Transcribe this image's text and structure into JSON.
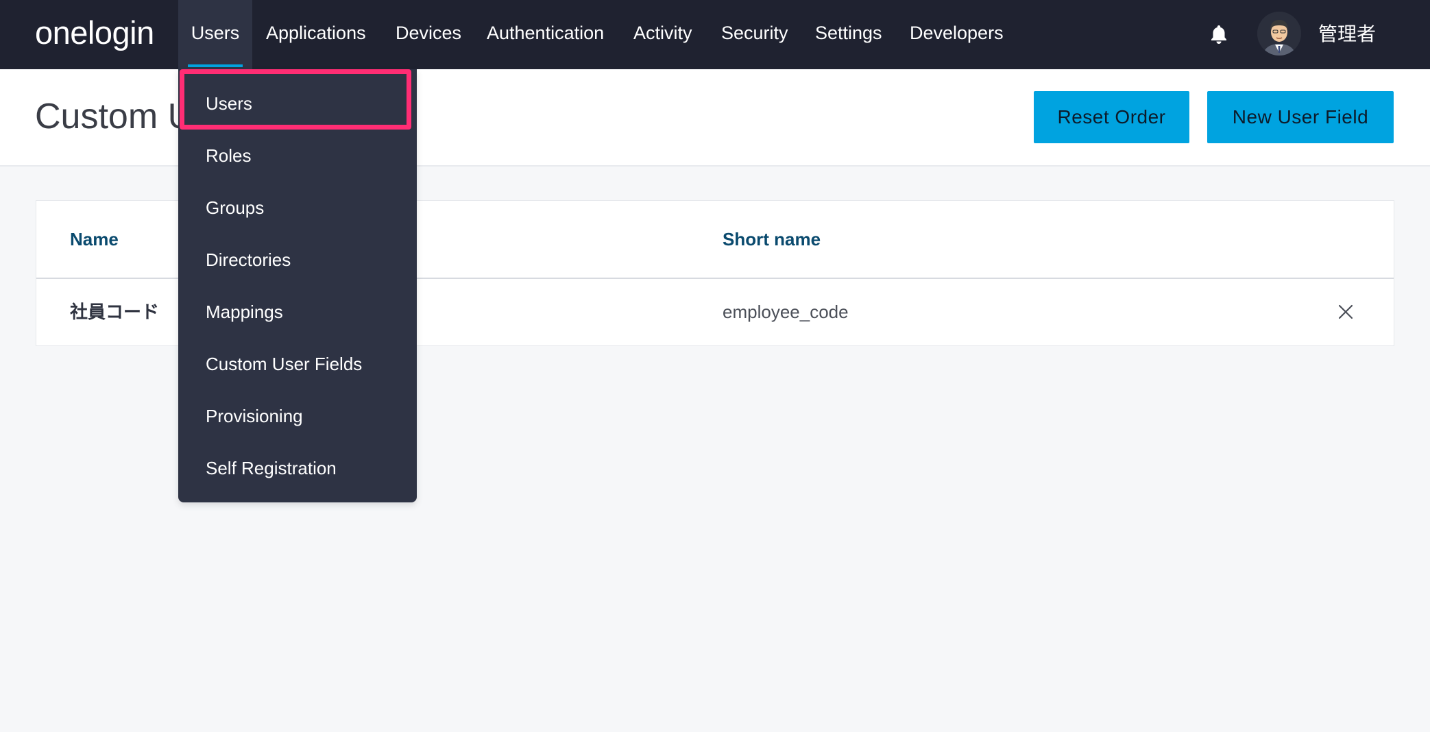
{
  "brand": {
    "logo_text": "onelogin"
  },
  "nav": {
    "items": [
      {
        "label": "Users",
        "active": true
      },
      {
        "label": "Applications"
      },
      {
        "label": "Devices"
      },
      {
        "label": "Authentication"
      },
      {
        "label": "Activity"
      },
      {
        "label": "Security"
      },
      {
        "label": "Settings"
      },
      {
        "label": "Developers"
      }
    ],
    "notification_icon": "bell-icon",
    "user": {
      "name": "管理者",
      "avatar_icon": "avatar-portrait"
    }
  },
  "page": {
    "title": "Custom User Fields",
    "title_visible": "Custom U",
    "reset_order_label": "Reset Order",
    "new_user_field_label": "New User Field"
  },
  "table": {
    "columns": [
      "Name",
      "Short name"
    ],
    "rows": [
      {
        "name": "社員コード",
        "short_name": "employee_code",
        "action_icon": "close-icon"
      }
    ]
  },
  "dropdown": {
    "items": [
      {
        "label": "Users",
        "highlighted": true
      },
      {
        "label": "Roles"
      },
      {
        "label": "Groups"
      },
      {
        "label": "Directories"
      },
      {
        "label": "Mappings"
      },
      {
        "label": "Custom User Fields"
      },
      {
        "label": "Provisioning"
      },
      {
        "label": "Self Registration"
      }
    ]
  },
  "colors": {
    "topbar": "#1f2230",
    "accent": "#00a3e0",
    "dropdown": "#2e3344",
    "highlight": "#ff2d74",
    "column_header": "#0a4a6e"
  }
}
